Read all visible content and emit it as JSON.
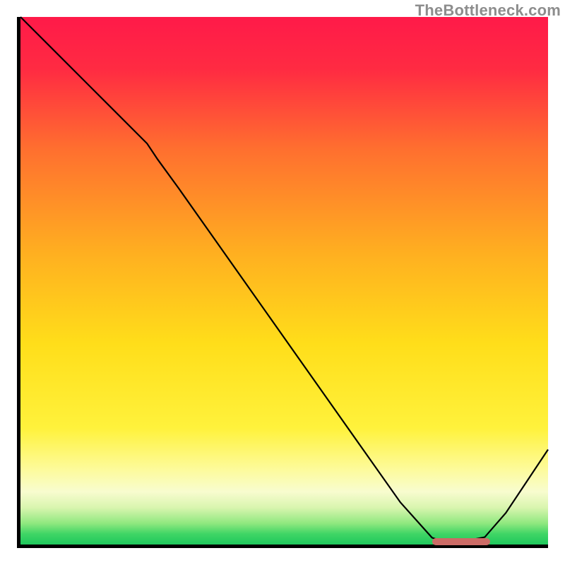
{
  "watermark": "TheBottleneck.com",
  "chart_data": {
    "type": "line",
    "title": "",
    "xlabel": "",
    "ylabel": "",
    "xlim": [
      0,
      100
    ],
    "ylim": [
      0,
      100
    ],
    "legend": false,
    "grid": false,
    "x": [
      0,
      6,
      12,
      18,
      24,
      26,
      30,
      36,
      42,
      48,
      54,
      60,
      66,
      72,
      78,
      80,
      84,
      88,
      92,
      96,
      100
    ],
    "values": [
      100,
      94,
      88,
      82,
      76,
      73,
      67.5,
      59,
      50.5,
      42,
      33.5,
      25,
      16.5,
      8,
      1.3,
      0.6,
      0.6,
      1.4,
      6,
      12,
      18
    ],
    "gradient_stops": [
      {
        "pct": 0,
        "color": "#ff1a49"
      },
      {
        "pct": 10,
        "color": "#ff2b42"
      },
      {
        "pct": 25,
        "color": "#ff6f2f"
      },
      {
        "pct": 45,
        "color": "#ffb020"
      },
      {
        "pct": 62,
        "color": "#ffde1a"
      },
      {
        "pct": 78,
        "color": "#fff23c"
      },
      {
        "pct": 86,
        "color": "#fdfb9e"
      },
      {
        "pct": 90,
        "color": "#f8fccf"
      },
      {
        "pct": 93,
        "color": "#d9f5af"
      },
      {
        "pct": 96,
        "color": "#8fe87f"
      },
      {
        "pct": 98,
        "color": "#3fd565"
      },
      {
        "pct": 100,
        "color": "#1fc85c"
      }
    ],
    "marker": {
      "x_start": 78,
      "x_end": 89,
      "y": 0.6,
      "color": "#cc6b66"
    },
    "curve_color": "#000000",
    "curve_width": 2.2
  }
}
